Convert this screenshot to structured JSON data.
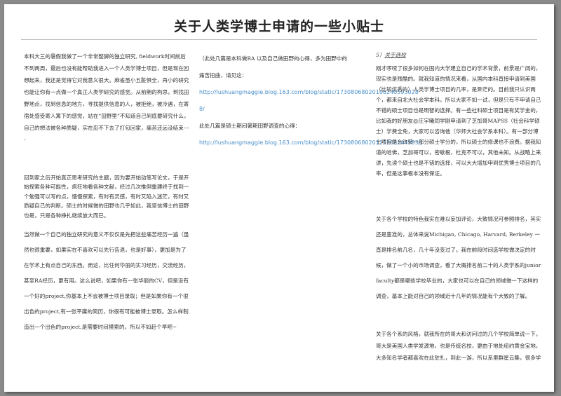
{
  "title": "关于人类学博士申请的一些小贴士",
  "col1": {
    "p1": "本科大三的暑假我做了一个非常整脚的独立研究, fieldwork时间前后不到两周，最后也没有能帮助我进入一个人类学博士项目，但是现在回想起来，我还是觉得它对我意义很大。麻雀虽小五脏俱全，再小的研究也能让你有一点做一个真正人类学研究的感觉。从前期的构思，到找田野地点，找到信息的地方，寻找提供信息的人，被拒绝，被冷遇，在寄宿处感受寄人篱下的感觉，站在“田野里”不知道自己到底要研究什么，自己的想法被各种质疑，实在忍不下去了打包回家，痛苦还远没结束----",
    "p2": "回到家之后开始真正思考研究的主题，因为要开始动笔写论文，于是开始探索各种可能性，疯狂地看各种文献，经过几次推倒重建终于找到一个勉强可以写的点，慢慢探索，有时有灵感，有时又陷入迷茫，有时又质疑自己的判断。硕士的时候做的田野也几乎如此，我坚信博士的田野也是，只是各种挣扎继续放大而已。",
    "p3": "当然做一个自己的独立研究的意义不仅仅是先把这些痛苦经历一遍（虽然也很重要，如果实在不喜欢可以先行告退，也是好事），更加是为了在学术上有点自己的东西。而这，比任何华丽的实习经历，交流经历，甚至RA经历，更有用。这么说吧，如果你有一张华丽的CV，但是没有一个好的project,你基本上不会被博士项目录取；但是如果你有一个很出色的project,有一张平庸的简历，你很有可能被博士录取。怎么样制造出一个出色的project,是需要时间摸索的。所以不如赶个早吧~"
  },
  "col2": {
    "intro1": "（此处几篇是本科做RA 以及自己做田野的心得，多为田野中的痛苦扭曲，请见这：",
    "link1": "http://lushuangmaggie.blog.163.com/blog/static/17308068020106240593028 8/",
    "intro2": "此处几篇是硕士期间暑期田野调查的心得：",
    "link2": "http://lushuangmaggie.blog.163.com/blog/static/17308068020125383144583/）"
  },
  "col3": {
    "heading_num": "5）",
    "heading_text": "关于选校",
    "p1": "刚才啰嗦了很多如何在国内大学建立自己的学术背景，前景是广阔的，现实也是残酷的。就我知道的情况来看，从国内本科直接申请到美国（比较优秀的）人类学博士项目的几率，是渺茫的。目前我只认识两个，都来自北大社会学本科。所以大家不如一试，但是只有不申请自己不错的硕士项目也是明智的选择。有一些社科硕士项目是有奖学金的，比如我的好朋友@庄宇曦同学刚申请到了芝加哥MAPSS（社会科学硕士）学费全免，大家可以咨询他（华师大社会学系本科）。有一部分博士项目是允许转一部分硕士学分的，所以硕士的修课也不浪费。据我知道的哈佛，芝加哥可以，密歇根，杜克不可以，其他未知。从战略上来讲，先读个硕士也是不错的选择，可以大大增加申到优秀博士项目的几率，但是这事根本没有保证。",
    "p2": "关于各个学校的特色我实在难以妄加评论，大致情况可参照排名，其实还是蛮准的，总体来说Michigan, Chicago, Harvard, Berkeley 一直是排名前几名，几十年没变过了。我在前段时间选学校做决定的时候，做了一个小的市场调查，看了大概排名前二十的人类学系的junior faculty都是哪些学校毕业的，大家也可以在自己的领域做一下这样的调查，基本上能对自己的领域近十几年的情况能有个大致的了解。",
    "p3": "关于各个系的风格，就我所在的哥大和访问过的几个学校简单说一下。哥大是美国人类学发源地，也是传统名校，更由于地处纽约黄金宝地，大多知名学者都喜欢在此驻扎，到此一游，所以系里群星云集，很多学"
  }
}
